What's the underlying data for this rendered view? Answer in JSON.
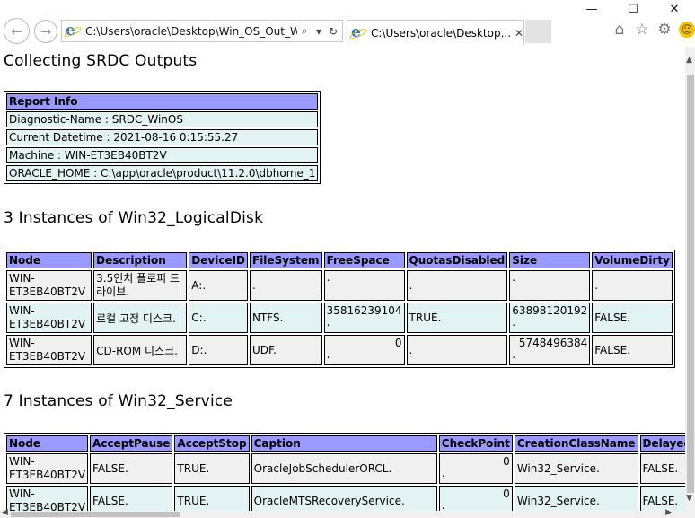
{
  "window": {
    "minimize": "—",
    "maximize": "☐",
    "close": "✕"
  },
  "browser": {
    "back_icon": "←",
    "forward_icon": "→",
    "address": "C:\\Users\\oracle\\Desktop\\Win_OS_Out_W",
    "search_icon": "⌕",
    "dropdown_icon": "▾",
    "refresh_icon": "↻",
    "tab_title": "C:\\Users\\oracle\\Desktop...",
    "tab_close": "✕",
    "home_icon": "⌂",
    "favorites_icon": "☆",
    "settings_icon": "⚙",
    "feedback_icon": "☺"
  },
  "page": {
    "title": "Collecting SRDC Outputs",
    "report": {
      "header": "Report Info",
      "rows": [
        "Diagnostic-Name : SRDC_WinOS",
        "Current Datetime : 2021-08-16 0:15:55.27",
        "Machine : WIN-ET3EB40BT2V",
        "ORACLE_HOME : C:\\app\\oracle\\product\\11.2.0\\dbhome_1"
      ]
    },
    "logical_disk": {
      "heading": "3 Instances of Win32_LogicalDisk",
      "columns": [
        "Node",
        "Description",
        "DeviceID",
        "FileSystem",
        "FreeSpace",
        "QuotasDisabled",
        "Size",
        "VolumeDirty"
      ],
      "rows": [
        {
          "node": [
            "WIN-",
            "ET3EB40BT2V"
          ],
          "description": "3.5인치 플로피 드라이브.",
          "deviceid": "A:.",
          "filesystem": ".",
          "freespace_top": "",
          "freespace_dot": ".",
          "quotas": ".",
          "size_top": "",
          "size_dot": ".",
          "dirty": "."
        },
        {
          "node": [
            "WIN-",
            "ET3EB40BT2V"
          ],
          "description": "로컬 고정 디스크.",
          "deviceid": "C:.",
          "filesystem": "NTFS.",
          "freespace_top": "35816239104",
          "freespace_dot": ".",
          "quotas": "TRUE.",
          "size_top": "63898120192",
          "size_dot": ".",
          "dirty": "FALSE."
        },
        {
          "node": [
            "WIN-",
            "ET3EB40BT2V"
          ],
          "description": "CD-ROM 디스크.",
          "deviceid": "D:.",
          "filesystem": "UDF.",
          "freespace_top": "0",
          "freespace_dot": ".",
          "quotas": ".",
          "size_top": "5748496384",
          "size_dot": ".",
          "dirty": "FALSE."
        }
      ]
    },
    "service": {
      "heading": "7 Instances of Win32_Service",
      "columns": [
        "Node",
        "AcceptPause",
        "AcceptStop",
        "Caption",
        "CheckPoint",
        "CreationClassName",
        "Delayed"
      ],
      "rows": [
        {
          "node": [
            "WIN-",
            "ET3EB40BT2V"
          ],
          "pause": "FALSE.",
          "stop": "TRUE.",
          "caption": "OracleJobSchedulerORCL.",
          "check_top": "0",
          "check_dot": ".",
          "cls": "Win32_Service.",
          "delayed": "FALSE."
        },
        {
          "node": [
            "WIN-",
            "ET3EB40BT2V"
          ],
          "pause": "FALSE.",
          "stop": "TRUE.",
          "caption": "OracleMTSRecoveryService.",
          "check_top": "0",
          "check_dot": ".",
          "cls": "Win32_Service.",
          "delayed": "FALSE."
        }
      ]
    }
  }
}
